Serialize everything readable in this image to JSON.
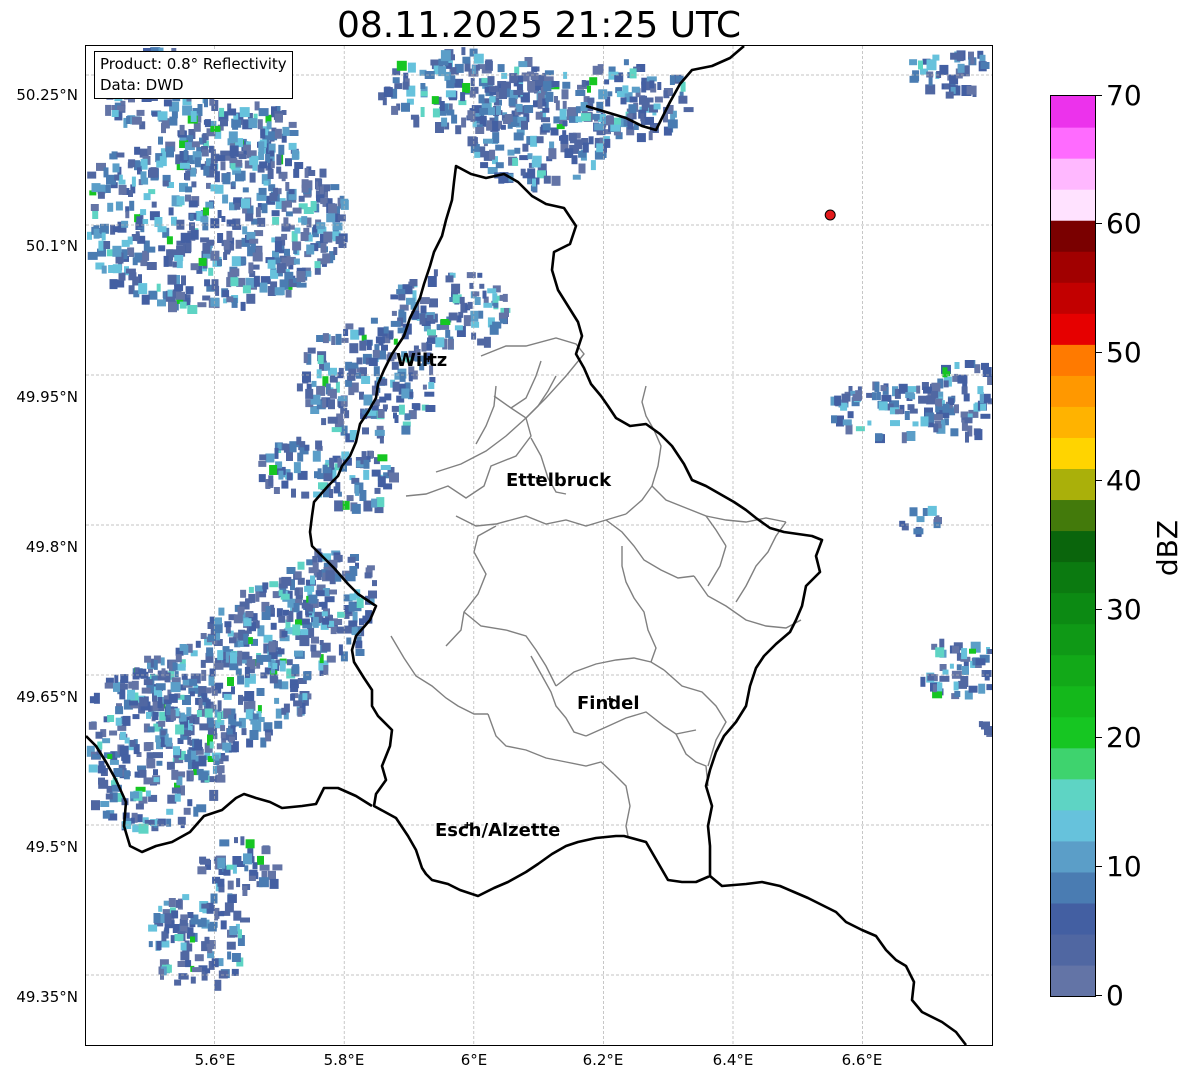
{
  "title": "08.11.2025 21:25 UTC",
  "info": {
    "product": "Product: 0.8° Reflectivity",
    "source": "Data: DWD"
  },
  "lat_labels": [
    "50.25°N",
    "50.1°N",
    "49.95°N",
    "49.8°N",
    "49.65°N",
    "49.5°N",
    "49.35°N"
  ],
  "lon_labels": [
    "5.6°E",
    "5.8°E",
    "6°E",
    "6.2°E",
    "6.4°E",
    "6.6°E"
  ],
  "cities": [
    {
      "name": "Wiltz",
      "lon": 5.93,
      "lat": 49.966
    },
    {
      "name": "Ettelbruck",
      "lon": 6.1,
      "lat": 49.847
    },
    {
      "name": "Findel",
      "lon": 6.21,
      "lat": 49.626
    },
    {
      "name": "Esch/Alzette",
      "lon": 5.99,
      "lat": 49.5
    }
  ],
  "marker": {
    "lon": 6.55,
    "lat": 50.11,
    "color": "#e31a1c"
  },
  "colorbar": {
    "label": "dBZ",
    "min": 0,
    "max": 70,
    "ticks": [
      "0",
      "10",
      "20",
      "30",
      "40",
      "50",
      "60",
      "70"
    ],
    "colors": [
      "#6374a6",
      "#5067a2",
      "#435fa2",
      "#4a7cb2",
      "#5b9ec8",
      "#66c2dc",
      "#5ed4c4",
      "#3ed36e",
      "#16c622",
      "#14b81b",
      "#12a918",
      "#0f9916",
      "#0c8a13",
      "#0b7a10",
      "#0a650c",
      "#437a0b",
      "#aab00a",
      "#ffd400",
      "#ffb300",
      "#ff9800",
      "#ff7a00",
      "#e60000",
      "#c20000",
      "#a10000",
      "#7a0000",
      "#ffe2ff",
      "#ffb8ff",
      "#ff6bff",
      "#ec32ec"
    ]
  },
  "colors": {
    "border_country": "#000000",
    "border_canton": "#808080",
    "grid": "#b0b0b0"
  }
}
